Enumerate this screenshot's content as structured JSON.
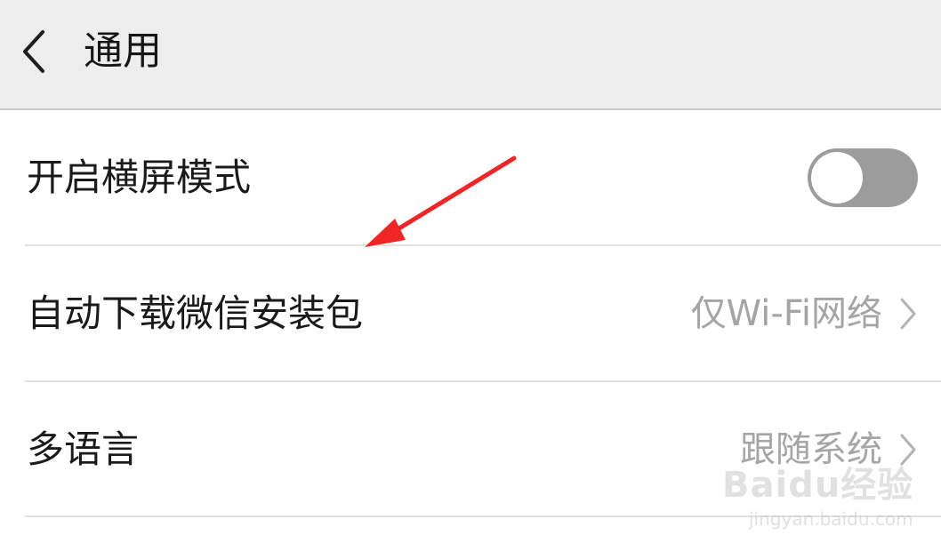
{
  "header": {
    "back_icon": "chevron-left-icon",
    "title": "通用"
  },
  "settings": [
    {
      "label": "开启横屏模式",
      "control": "toggle",
      "toggle_on": false
    },
    {
      "label": "自动下载微信安装包",
      "value": "仅Wi-Fi网络",
      "icon": "chevron-right-icon"
    },
    {
      "label": "多语言",
      "value": "跟随系统",
      "icon": "chevron-right-icon"
    }
  ],
  "annotation": {
    "type": "red-arrow",
    "color": "#f02525"
  },
  "watermark": {
    "logo": "Baidu经验",
    "url": "jingyan.baidu.com"
  },
  "colors": {
    "header_bg": "#ededed",
    "toggle_off": "#9c9c9c",
    "value_text": "#a5a5a5",
    "divider": "#e1e1e1"
  }
}
